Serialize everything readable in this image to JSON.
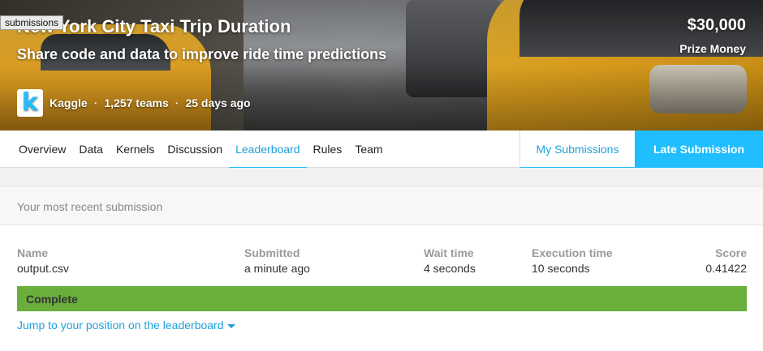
{
  "tooltip": {
    "label": "submissions"
  },
  "competition": {
    "title": "New York City Taxi Trip Duration",
    "subtitle": "Share code and data to improve ride time predictions",
    "host": "Kaggle",
    "host_logo_letter": "k",
    "separator": "·",
    "teams": "1,257 teams",
    "time_ago": "25 days ago",
    "prize_amount": "$30,000",
    "prize_label": "Prize Money"
  },
  "tabs": [
    {
      "label": "Overview",
      "active": false
    },
    {
      "label": "Data",
      "active": false
    },
    {
      "label": "Kernels",
      "active": false
    },
    {
      "label": "Discussion",
      "active": false
    },
    {
      "label": "Leaderboard",
      "active": true
    },
    {
      "label": "Rules",
      "active": false
    },
    {
      "label": "Team",
      "active": false
    }
  ],
  "actions": {
    "my_submissions": "My Submissions",
    "late_submission": "Late Submission"
  },
  "submission": {
    "heading": "Your most recent submission",
    "columns": {
      "name": {
        "label": "Name",
        "value": "output.csv"
      },
      "submitted": {
        "label": "Submitted",
        "value": "a minute ago"
      },
      "wait_time": {
        "label": "Wait time",
        "value": "4 seconds"
      },
      "execution_time": {
        "label": "Execution time",
        "value": "10 seconds"
      },
      "score": {
        "label": "Score",
        "value": "0.41422"
      }
    },
    "status": "Complete",
    "jump_link": "Jump to your position on the leaderboard"
  },
  "colors": {
    "accent": "#20beff",
    "link": "#1fa1d9",
    "status_complete": "#6aae3c"
  }
}
